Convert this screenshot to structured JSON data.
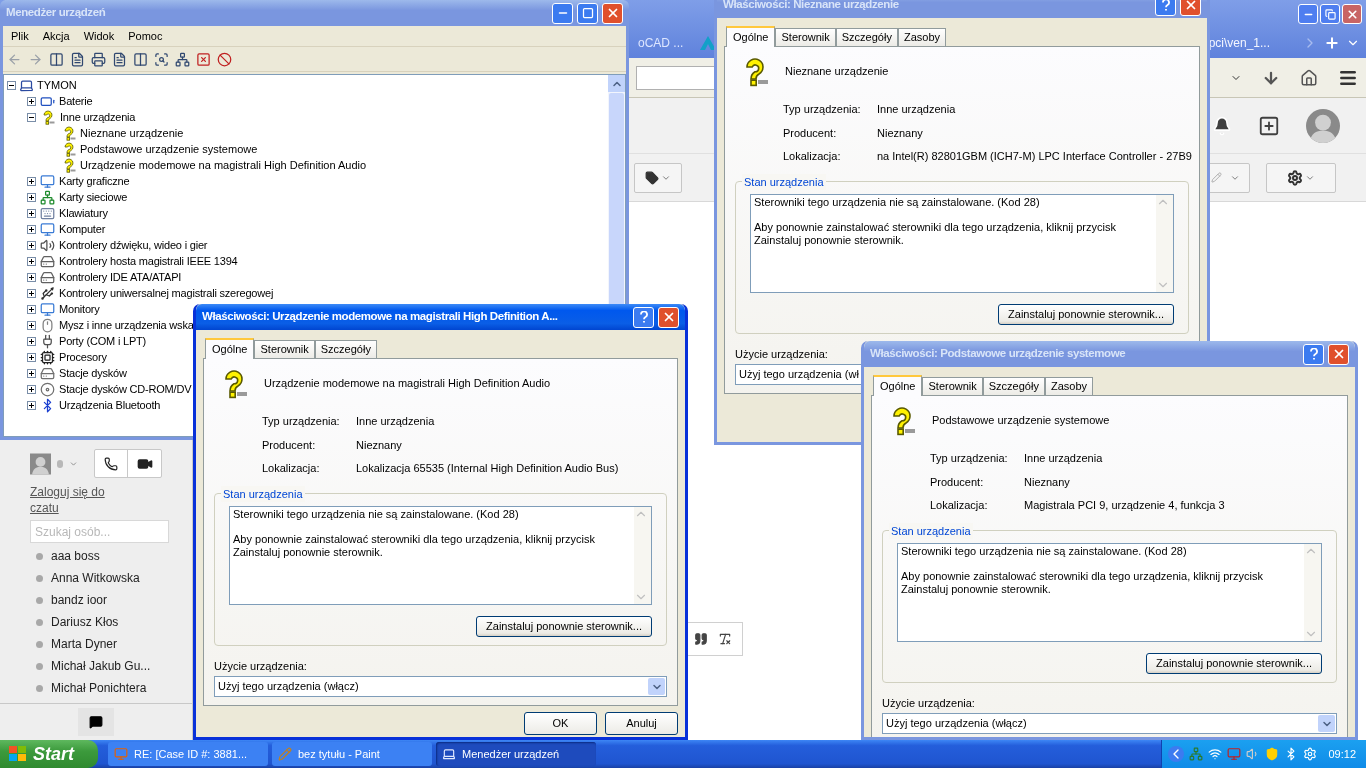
{
  "browser": {
    "tabs": [
      {
        "label": "oCAD ...",
        "selected": false
      },
      {
        "label": "pci\\ven_1...",
        "selected": true
      }
    ],
    "chat": {
      "login_link": "Zaloguj się do czatu",
      "search": {
        "placeholder": "Szukaj osób..."
      },
      "contacts": [
        "aaa boss",
        "Anna Witkowska",
        "bandz ioor",
        "Dariusz Kłos",
        "Marta Dyner",
        "Michał Jakub Gu...",
        "Michał Ponichtera"
      ]
    }
  },
  "device_manager": {
    "title": "Menedżer urządzeń",
    "active": false,
    "menu": [
      "Plik",
      "Akcja",
      "Widok",
      "Pomoc"
    ],
    "tree": {
      "label": "TYMON",
      "expanded": true,
      "children": [
        {
          "label": "Baterie",
          "expanded": false,
          "warning": false
        },
        {
          "label": "Inne urządzenia",
          "expanded": true,
          "warning": true,
          "children": [
            {
              "label": "Nieznane urządzenie",
              "warning": true
            },
            {
              "label": "Podstawowe urządzenie systemowe",
              "warning": true
            },
            {
              "label": "Urządzenie modemowe na magistrali High Definition Audio",
              "warning": true
            }
          ]
        },
        {
          "label": "Karty graficzne",
          "expanded": false,
          "warning": false
        },
        {
          "label": "Karty sieciowe",
          "expanded": false,
          "warning": false
        },
        {
          "label": "Klawiatury",
          "expanded": false,
          "warning": false
        },
        {
          "label": "Komputer",
          "expanded": false,
          "warning": false
        },
        {
          "label": "Kontrolery dźwięku, wideo i gier",
          "expanded": false,
          "warning": false
        },
        {
          "label": "Kontrolery hosta magistrali IEEE 1394",
          "expanded": false,
          "warning": false
        },
        {
          "label": "Kontrolery IDE ATA/ATAPI",
          "expanded": false,
          "warning": false
        },
        {
          "label": "Kontrolery uniwersalnej magistrali szeregowej",
          "expanded": false,
          "warning": false
        },
        {
          "label": "Monitory",
          "expanded": false,
          "warning": false
        },
        {
          "label": "Mysz i inne urządzenia wska",
          "expanded": false,
          "warning": false
        },
        {
          "label": "Porty (COM i LPT)",
          "expanded": false,
          "warning": false
        },
        {
          "label": "Procesory",
          "expanded": false,
          "warning": false
        },
        {
          "label": "Stacje dysków",
          "expanded": false,
          "warning": false
        },
        {
          "label": "Stacje dysków CD-ROM/DV",
          "expanded": false,
          "warning": false
        },
        {
          "label": "Urządzenia Bluetooth",
          "expanded": false,
          "warning": false
        }
      ]
    }
  },
  "dialogs": [
    {
      "title": "Właściwości: Nieznane urządzenie",
      "active": false,
      "tabs": [
        {
          "label": "Ogólne",
          "selected": true
        },
        {
          "label": "Sterownik",
          "selected": false
        },
        {
          "label": "Szczegóły",
          "selected": false
        },
        {
          "label": "Zasoby",
          "selected": false
        }
      ],
      "device_name": "Nieznane urządzenie",
      "properties": [
        {
          "label": "Typ urządzenia:",
          "value": "Inne urządzenia"
        },
        {
          "label": "Producent:",
          "value": "Nieznany"
        },
        {
          "label": "Lokalizacja:",
          "value": "na Intel(R) 82801GBM (ICH7-M) LPC Interface Controller - 27B9"
        }
      ],
      "status_group": "Stan urządzenia",
      "status_text": [
        [
          "Sterowniki tego urządzenia nie są zainstalowane. (Kod 28)"
        ],
        [
          "Aby ponownie zainstalować sterowniki dla tego urządzenia, kliknij przycisk",
          "Zainstaluj ponownie sterownik."
        ]
      ],
      "reinstall_button": "Zainstaluj ponownie sterownik...",
      "usage_label": "Użycie urządzenia:",
      "usage_value": "Użyj tego urządzenia (wł"
    },
    {
      "title": "Właściwości: Urządzenie modemowe na magistrali High Definition A...",
      "active": true,
      "tabs": [
        {
          "label": "Ogólne",
          "selected": true
        },
        {
          "label": "Sterownik",
          "selected": false
        },
        {
          "label": "Szczegóły",
          "selected": false
        }
      ],
      "device_name": "Urządzenie modemowe na magistrali High Definition Audio",
      "properties": [
        {
          "label": "Typ urządzenia:",
          "value": "Inne urządzenia"
        },
        {
          "label": "Producent:",
          "value": "Nieznany"
        },
        {
          "label": "Lokalizacja:",
          "value": "Lokalizacja 65535 (Internal High Definition Audio Bus)"
        }
      ],
      "status_group": "Stan urządzenia",
      "status_text": [
        [
          "Sterowniki tego urządzenia nie są zainstalowane. (Kod 28)"
        ],
        [
          "Aby ponownie zainstalować sterowniki dla tego urządzenia, kliknij przycisk",
          "Zainstaluj ponownie sterownik."
        ]
      ],
      "reinstall_button": "Zainstaluj ponownie sterownik...",
      "usage_label": "Użycie urządzenia:",
      "usage_value": "Użyj tego urządzenia (włącz)",
      "buttons": [
        "OK",
        "Anuluj"
      ]
    },
    {
      "title": "Właściwości: Podstawowe urządzenie systemowe",
      "active": false,
      "tabs": [
        {
          "label": "Ogólne",
          "selected": true
        },
        {
          "label": "Sterownik",
          "selected": false
        },
        {
          "label": "Szczegóły",
          "selected": false
        },
        {
          "label": "Zasoby",
          "selected": false
        }
      ],
      "device_name": "Podstawowe urządzenie systemowe",
      "properties": [
        {
          "label": "Typ urządzenia:",
          "value": "Inne urządzenia"
        },
        {
          "label": "Producent:",
          "value": "Nieznany"
        },
        {
          "label": "Lokalizacja:",
          "value": "Magistrala PCI 9, urządzenie 4, funkcja 3"
        }
      ],
      "status_group": "Stan urządzenia",
      "status_text": [
        [
          "Sterowniki tego urządzenia nie są zainstalowane. (Kod 28)"
        ],
        [
          "Aby ponownie zainstalować sterowniki dla tego urządzenia, kliknij przycisk",
          "Zainstaluj ponownie sterownik."
        ]
      ],
      "reinstall_button": "Zainstaluj ponownie sterownik...",
      "usage_label": "Użycie urządzenia:",
      "usage_value": "Użyj tego urządzenia (włącz)"
    }
  ],
  "taskbar": {
    "start": "Start",
    "tasks": [
      {
        "label": "RE: [Case ID #: 3881...",
        "selected": false
      },
      {
        "label": "bez tytułu - Paint",
        "selected": false
      },
      {
        "label": "Menedżer urządzeń",
        "selected": true
      }
    ],
    "clock": "09:12"
  }
}
